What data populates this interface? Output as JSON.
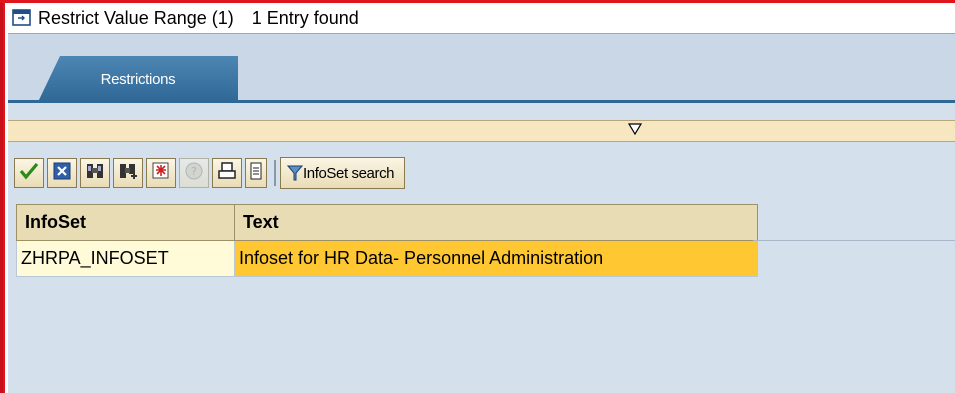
{
  "window": {
    "title": "Restrict Value Range (1)",
    "entries_found": "1 Entry found"
  },
  "tabs": [
    {
      "label": "Restrictions",
      "active": true
    }
  ],
  "toolbar": {
    "buttons": [
      {
        "icon": "checkmark-icon"
      },
      {
        "icon": "cancel-x-icon"
      },
      {
        "icon": "find-icon"
      },
      {
        "icon": "find-next-icon"
      },
      {
        "icon": "new-entries-icon"
      },
      {
        "icon": "help-icon",
        "disabled": true
      },
      {
        "icon": "print-icon"
      },
      {
        "icon": "list-menu-icon"
      }
    ],
    "infoset_search_label": "InfoSet search"
  },
  "table": {
    "columns": [
      "InfoSet",
      "Text"
    ],
    "rows": [
      {
        "infoset": "ZHRPA_INFOSET",
        "text": "Infoset for HR Data- Personnel Administration"
      }
    ]
  },
  "colors": {
    "frame_red": "#e0141c",
    "tab_blue": "#2f6796",
    "selected_cell": "#ffc832",
    "header_bg": "#e8dcb4",
    "content_bg": "#d4e0ec"
  }
}
